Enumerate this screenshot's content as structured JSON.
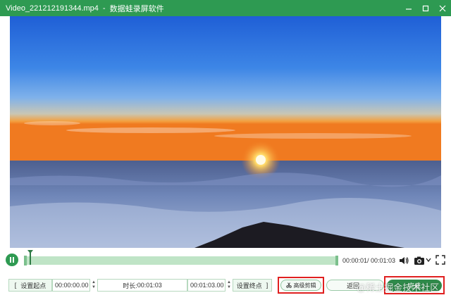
{
  "window": {
    "file_name": "Video_221212191344.mp4",
    "separator": "-",
    "app_name": "数据蛙录屏软件"
  },
  "window_controls": {
    "minimize_icon": "minimize-icon",
    "maximize_icon": "maximize-icon",
    "close_icon": "close-icon"
  },
  "player": {
    "progress_fraction": 0.01,
    "time_readout": "00:00:01/ 00:01:03"
  },
  "trim": {
    "set_start_label": "设置起点",
    "start_time": "00:00:00.00",
    "duration_label": "时长:",
    "duration_value": "00:01:03",
    "end_time": "00:01:03.00",
    "set_end_label": "设置终点",
    "advanced_edit_label": "高级剪辑",
    "bracket_open": "[",
    "bracket_close": "]"
  },
  "actions": {
    "back_label": "返回",
    "done_label": "完成"
  },
  "watermark": "@稀土掘金技术社区",
  "colors": {
    "accent": "#2e9a52",
    "track": "#a9d8b3",
    "highlight": "#e02020"
  }
}
